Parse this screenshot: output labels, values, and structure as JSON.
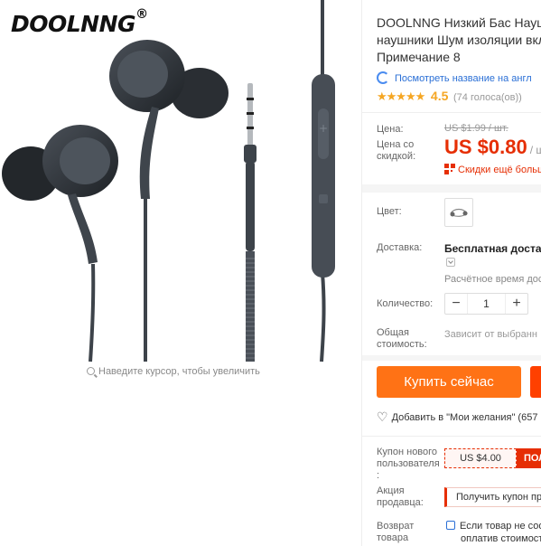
{
  "brand": {
    "name": "DOOLNNG",
    "mark": "®"
  },
  "gallery": {
    "zoom_hint": "Наведите курсор, чтобы увеличить"
  },
  "product": {
    "title_lines": [
      "DOOLNNG Низкий Бас Наушн",
      "наушники Шум изоляции вкл",
      "Примечание 8"
    ],
    "translate_link": "Посмотреть название на англ",
    "rating": {
      "stars": "★★★★★",
      "value": "4.5",
      "votes": "(74 голоса(ов))"
    }
  },
  "price": {
    "price_label": "Цена:",
    "old_price": "US $1.99 / шт.",
    "sale_label": "Цена со скидкой:",
    "sale_price": "US $0.80",
    "unit": "/ шт",
    "bulk_discount": "Скидки ещё больш"
  },
  "options": {
    "color_label": "Цвет:",
    "shipping_label": "Доставка:",
    "shipping_value": "Бесплатная доставк",
    "delivery_estimate": "Расчётное время дос",
    "quantity_label": "Количество:",
    "quantity_minus": "−",
    "quantity_value": "1",
    "quantity_plus": "+",
    "total_label": "Общая стоимость:",
    "total_value": "Зависит от выбранн"
  },
  "actions": {
    "buy_now": "Купить сейчас",
    "wishlist_label": "Добавить в \"Мои желания\" (657"
  },
  "promotions": {
    "new_user_coupon_label": "Купон нового пользователя :",
    "coupon_amount": "US $4.00",
    "coupon_get": "ПОЛ",
    "seller_promo_label": "Акция продавца:",
    "seller_promo_value": "Получить купон пр",
    "return_label": "Возврат товара",
    "return_text_lines": [
      "Если товар не соо",
      "оплатив стоимость"
    ]
  },
  "colors": {
    "accent": "#ff7215",
    "price_red": "#e62e04",
    "link_blue": "#2a6fd6",
    "star": "#f5a623"
  }
}
